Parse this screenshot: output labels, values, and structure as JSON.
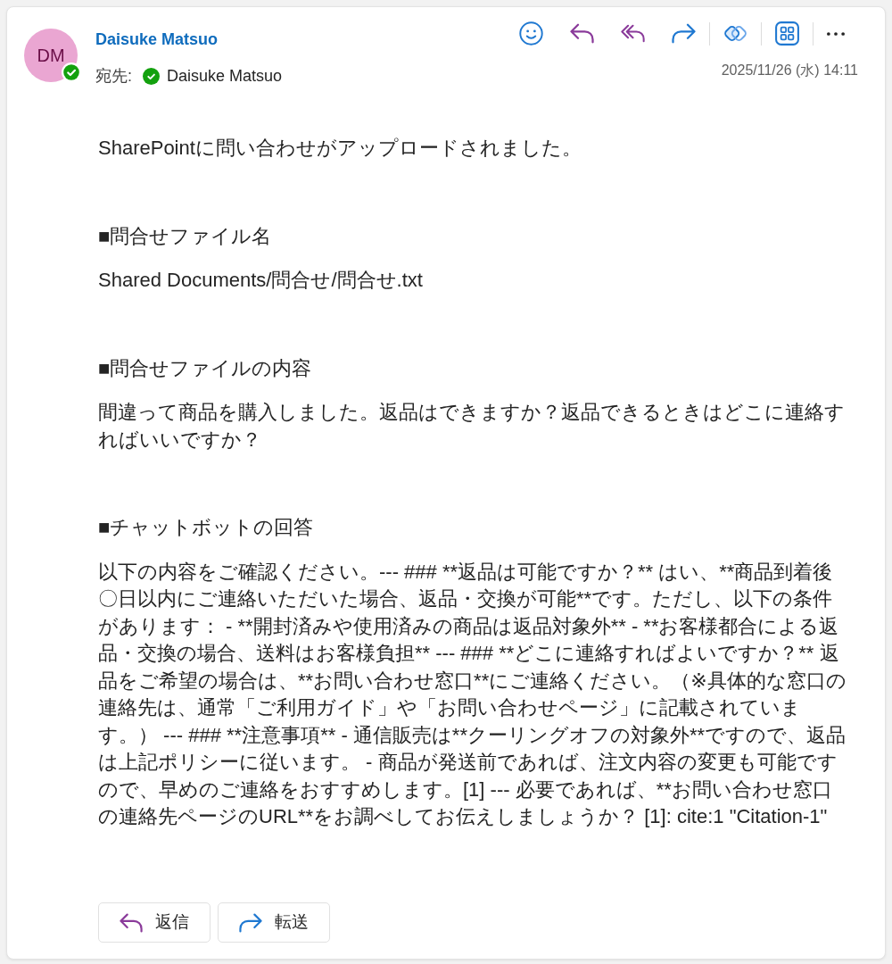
{
  "sender": {
    "initials": "DM",
    "name": "Daisuke Matsuo",
    "available": true
  },
  "recipient": {
    "label": "宛先:",
    "name": "Daisuke Matsuo",
    "available": true
  },
  "toolbar_groups": [
    {
      "items": [
        {
          "kind": "emoji"
        },
        {
          "kind": "reply"
        },
        {
          "kind": "reply_all"
        },
        {
          "kind": "forward"
        }
      ]
    },
    {
      "items": [
        {
          "kind": "loop"
        }
      ]
    },
    {
      "items": [
        {
          "kind": "apps"
        }
      ]
    },
    {
      "items": [
        {
          "kind": "more"
        }
      ]
    }
  ],
  "date": "2025/11/26 (水) 14:11",
  "body": {
    "intro": "SharePointに問い合わせがアップロードされました。",
    "sections": [
      {
        "heading": "■問合せファイル名",
        "text": "Shared Documents/問合せ/問合せ.txt"
      },
      {
        "heading": "■問合せファイルの内容",
        "text": "間違って商品を購入しました。返品はできますか？返品できるときはどこに連絡すればいいですか？"
      },
      {
        "heading": "■チャットボットの回答",
        "text": "以下の内容をご確認ください。--- ### **返品は可能ですか？** はい、**商品到着後〇日以内にご連絡いただいた場合、返品・交換が可能**です。ただし、以下の条件があります： - **開封済みや使用済みの商品は返品対象外** - **お客様都合による返品・交換の場合、送料はお客様負担** --- ### **どこに連絡すればよいですか？** 返品をご希望の場合は、**お問い合わせ窓口**にご連絡ください。（※具体的な窓口の連絡先は、通常「ご利用ガイド」や「お問い合わせページ」に記載されています。） --- ### **注意事項** - 通信販売は**クーリングオフの対象外**ですので、返品は上記ポリシーに従います。 - 商品が発送前であれば、注文内容の変更も可能ですので、早めのご連絡をおすすめします。[1] --- 必要であれば、**お問い合わせ窓口の連絡先ページのURL**をお調べしてお伝えしましょうか？ [1]: cite:1 \"Citation-1\""
      }
    ]
  },
  "actions": [
    {
      "kind": "reply",
      "label": "返信"
    },
    {
      "kind": "forward",
      "label": "転送"
    }
  ]
}
